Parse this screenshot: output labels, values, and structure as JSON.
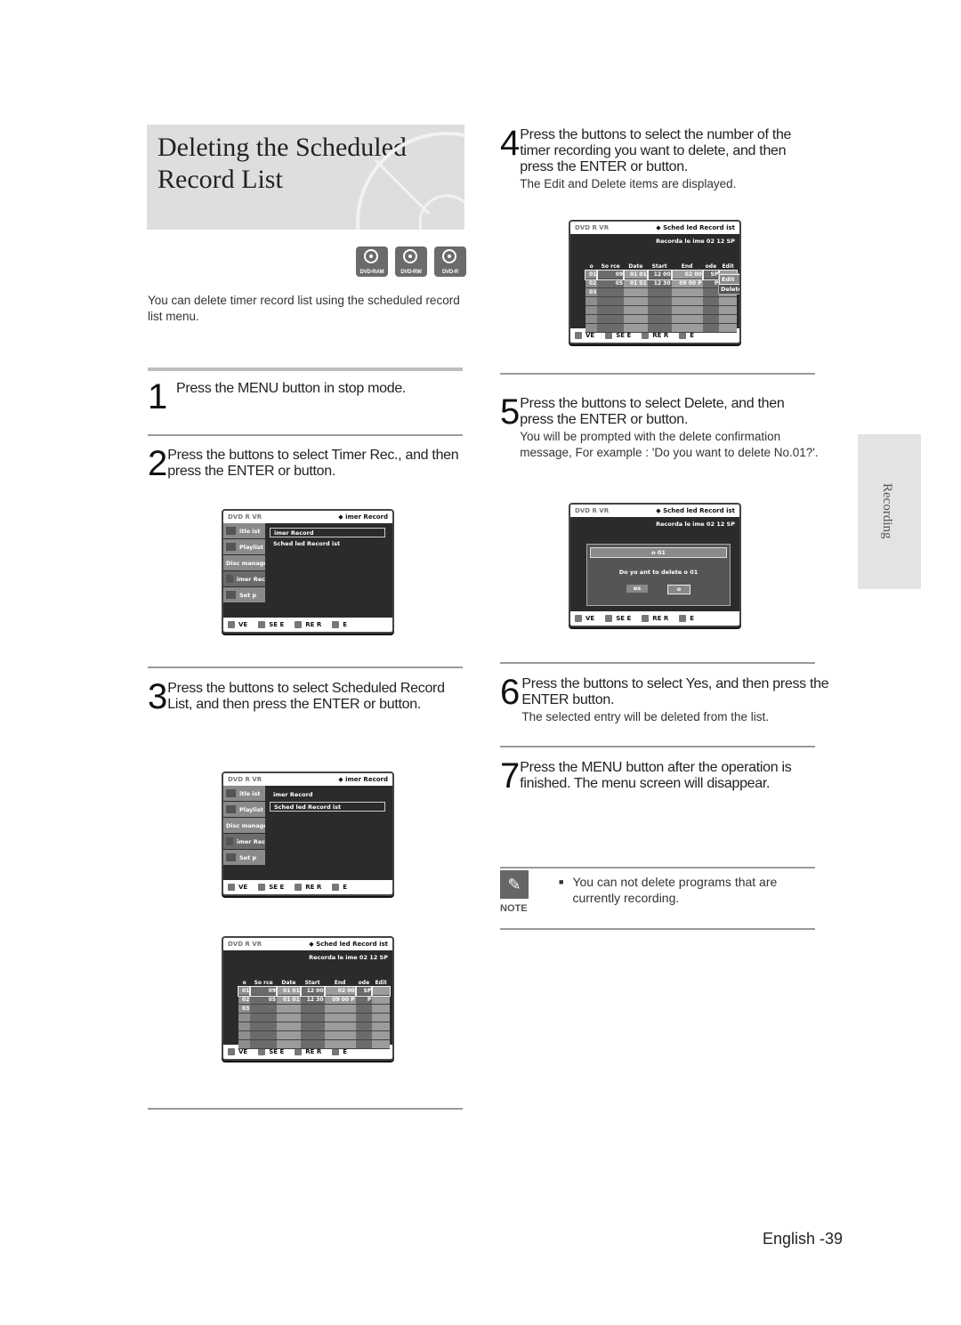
{
  "page": {
    "title": "Deleting the Scheduled Record List",
    "disc_badges": [
      "DVD-RAM",
      "DVD-RW",
      "DVD-R"
    ],
    "intro": "You can delete timer record list using the scheduled record list menu.",
    "side_tab": "Recording",
    "footer": "English -39"
  },
  "steps": [
    {
      "num": "1",
      "text": "Press the MENU button in stop mode.",
      "sub": ""
    },
    {
      "num": "2",
      "text": "Press the      buttons to select Timer Rec., and then press the ENTER or   button.",
      "sub": ""
    },
    {
      "num": "3",
      "text": "Press the      buttons to select Scheduled Record List, and then press the ENTER or button.",
      "sub": ""
    },
    {
      "num": "4",
      "text": "Press the      buttons to select the number of the timer recording you want to delete, and then press the ENTER or   button.",
      "sub": "The Edit and Delete items are displayed."
    },
    {
      "num": "5",
      "text": "Press the      buttons to select Delete, and then press the ENTER or   button.",
      "sub": "You will be prompted with the delete confirmation message, For example : 'Do you want to delete No.01?'."
    },
    {
      "num": "6",
      "text": "Press the      buttons to select Yes, and then press the ENTER button.",
      "sub": "The selected entry will be deleted from the list."
    },
    {
      "num": "7",
      "text": "Press the MENU button after the operation is finished. The menu screen will disappear.",
      "sub": ""
    }
  ],
  "note": {
    "label": "NOTE",
    "items": [
      "You can not delete programs that are currently recording."
    ]
  },
  "screens": {
    "header_left": "DVD R     VR",
    "timer_title": "◆ imer Record",
    "sched_title": "◆ Sched  led Record  ist",
    "side_items": [
      "itle  ist",
      "Playlist",
      "Disc manager",
      "imer Rec",
      "Set  p"
    ],
    "menu_options": [
      "imer Record",
      "Sched  led Record  ist"
    ],
    "rec_time": "Recorda  le   ime 02 12 SP",
    "columns": [
      "o",
      "So rce",
      "Date",
      "Start",
      "End",
      "ode",
      "Edit"
    ],
    "rows": [
      [
        "01",
        "09",
        "01 01",
        "12 00",
        "02 00",
        "SP"
      ],
      [
        "02",
        "05",
        "01 01",
        "12 30",
        "09 00 P",
        "P"
      ],
      [
        "03",
        "",
        "",
        "",
        "",
        ""
      ]
    ],
    "edit_menu": [
      "Edit",
      "Delete"
    ],
    "dialog": {
      "title": "o  01",
      "message": "Do yo     ant to delete   o  01",
      "yes": "es",
      "no": "o"
    },
    "footer": [
      "VE",
      "SE E",
      "RE   R",
      "E"
    ]
  }
}
